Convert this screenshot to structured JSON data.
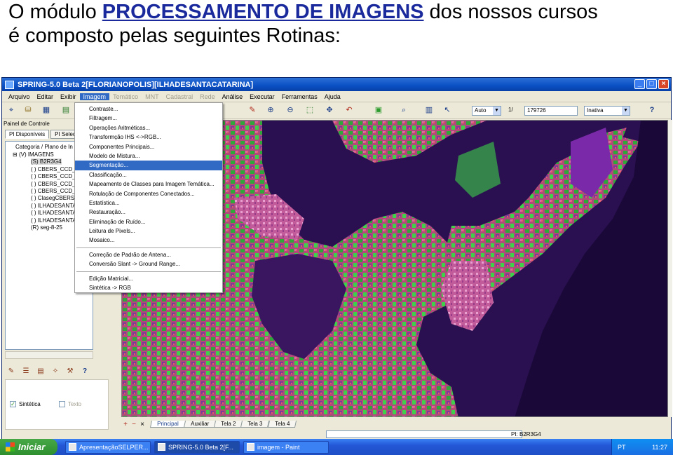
{
  "heading": {
    "prefix": "O módulo ",
    "highlight": "PROCESSAMENTO DE IMAGENS",
    "suffix": " dos nossos cursos",
    "line2": "é composto pelas seguintes Rotinas:"
  },
  "window": {
    "title": "SPRING-5.0 Beta 2[FLORIANOPOLIS][ILHADESANTACATARINA]",
    "controls": [
      "_",
      "□",
      "×"
    ]
  },
  "menubar": [
    {
      "label": "Arquivo",
      "state": "normal"
    },
    {
      "label": "Editar",
      "state": "normal"
    },
    {
      "label": "Exibir",
      "state": "normal"
    },
    {
      "label": "Imagem",
      "state": "active"
    },
    {
      "label": "Temático",
      "state": "disabled"
    },
    {
      "label": "MNT",
      "state": "disabled"
    },
    {
      "label": "Cadastral",
      "state": "disabled"
    },
    {
      "label": "Rede",
      "state": "disabled"
    },
    {
      "label": "Análise",
      "state": "normal"
    },
    {
      "label": "Executar",
      "state": "normal"
    },
    {
      "label": "Ferramentas",
      "state": "normal"
    },
    {
      "label": "Ajuda",
      "state": "normal"
    }
  ],
  "toolbar": {
    "zoom_mode": "Auto",
    "page_label": "1/",
    "scale": "179726",
    "state": "Inativa",
    "help": "?"
  },
  "panel": {
    "title": "Painel de Controle",
    "tabs": [
      "PI Disponíveis",
      "PI Selec"
    ],
    "tree_header": "Categoria / Plano de In",
    "tree_items": [
      {
        "label": "(V) IMAGENS",
        "root": true,
        "selected": false
      },
      {
        "label": "(S) B2R3G4",
        "root": false,
        "selected": true
      },
      {
        "label": "( ) CBERS_CCD_B",
        "root": false,
        "selected": false
      },
      {
        "label": "( ) CBERS_CCD_B",
        "root": false,
        "selected": false
      },
      {
        "label": "( ) CBERS_CCD_B",
        "root": false,
        "selected": false
      },
      {
        "label": "( ) CBERS_CCD_B",
        "root": false,
        "selected": false
      },
      {
        "label": "( ) ClasegCBERS",
        "root": false,
        "selected": false
      },
      {
        "label": "( ) ILHADESANTAC",
        "root": false,
        "selected": false
      },
      {
        "label": "( ) ILHADESANTAC",
        "root": false,
        "selected": false
      },
      {
        "label": "( ) ILHADESANTAC",
        "root": false,
        "selected": false
      },
      {
        "label": "(R) seg-8-25",
        "root": false,
        "selected": false
      }
    ],
    "checkbox_sintetica": "Sintética",
    "checkbox_texto": "Texto"
  },
  "imagem_menu": {
    "groups": [
      [
        "Contraste...",
        "Filtragem...",
        "Operações Aritméticas...",
        "Transformção IHS <->RGB...",
        "Componentes Principais...",
        "Modelo de Mistura...",
        "Segmentação...",
        "Classificação...",
        "Mapeamento de Classes para Imagem Temática...",
        "Rotulação de Componentes Conectados...",
        "Estatística...",
        "Restauração...",
        "Eliminação de Ruído...",
        "Leitura de Pixels...",
        "Mosaico..."
      ],
      [
        "Correção de Padrão de Antena...",
        "Conversão Slant -> Ground Range..."
      ],
      [
        "Edição Matricial...",
        "Sintética -> RGB"
      ]
    ],
    "highlighted": "Segmentação..."
  },
  "bottom_tabs": {
    "controls": [
      "+",
      "−",
      "×"
    ],
    "tabs": [
      "Principal",
      "Auxiliar",
      "Tela 2",
      "Tela 3",
      "Tela 4"
    ],
    "selected": "Principal"
  },
  "status": {
    "pi": "PI: B2R3G4"
  },
  "taskbar": {
    "start": "Iniciar",
    "tasks": [
      "ApresentaçãoSELPER...",
      "SPRING-5.0 Beta 2[F...",
      "imagem - Paint"
    ],
    "active_task": 1,
    "lang": "PT",
    "clock": "11:27"
  },
  "colors": {
    "titlebar": "#0a4fc4",
    "menu_highlight": "#316ac5",
    "heading_highlight": "#1a2a9c"
  }
}
